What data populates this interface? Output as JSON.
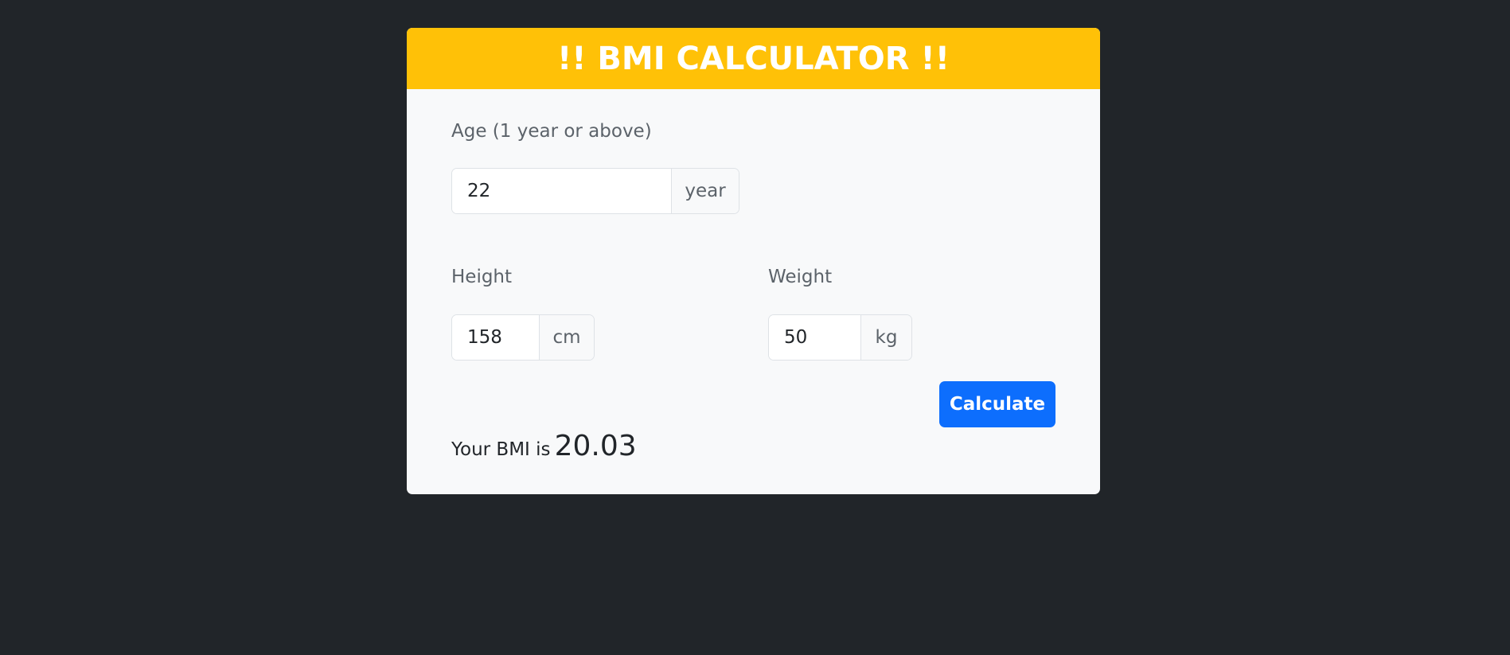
{
  "header": {
    "title": "!! BMI CALCULATOR !!"
  },
  "age": {
    "label": "Age (1 year or above)",
    "value": "22",
    "unit": "year"
  },
  "height": {
    "label": "Height",
    "value": "158",
    "unit": "cm"
  },
  "weight": {
    "label": "Weight",
    "value": "50",
    "unit": "kg"
  },
  "actions": {
    "calculate_label": "Calculate"
  },
  "result": {
    "label": "Your BMI is",
    "value": "20.03"
  },
  "colors": {
    "background": "#212529",
    "header": "#ffc107",
    "card": "#f8f9fa",
    "button": "#0d6efd"
  }
}
